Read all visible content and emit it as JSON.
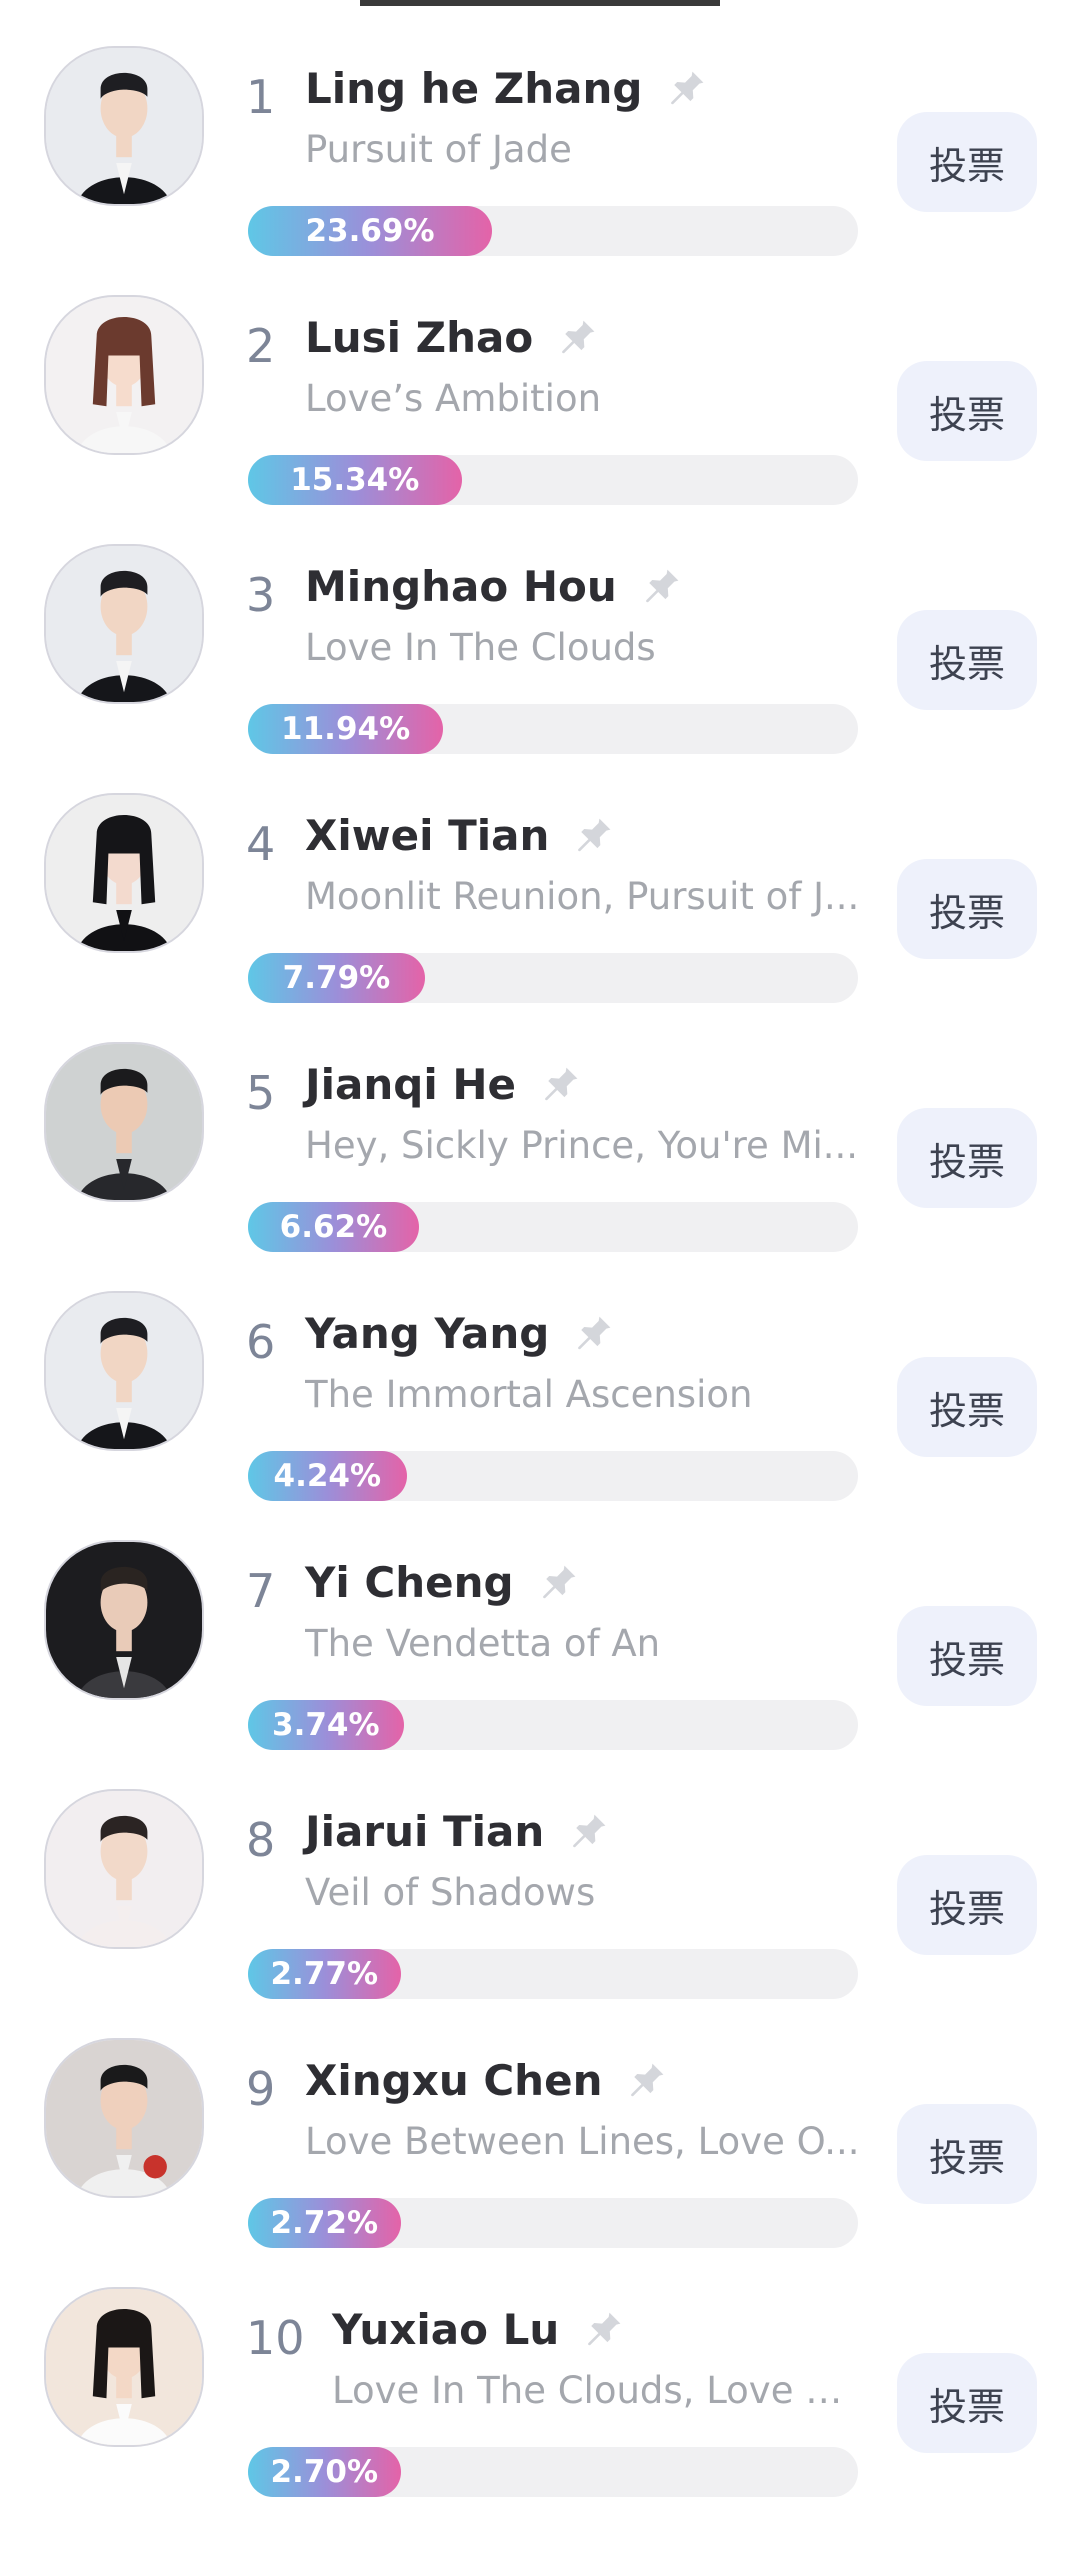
{
  "vote_label": "投票",
  "colors": {
    "bar_gradient_start": "#5fc7e6",
    "bar_gradient_end": "#e463a8",
    "vote_button_bg": "#eef1fb",
    "track_bg": "#f0f0f2"
  },
  "ranking": [
    {
      "rank": "1",
      "name": "Ling he Zhang",
      "work": "Pursuit of Jade",
      "percent_label": "23.69%",
      "share_fraction": 0.4,
      "avatar": "avatar-male-black-suit"
    },
    {
      "rank": "2",
      "name": "Lusi Zhao",
      "work": "Love’s Ambition",
      "percent_label": "15.34%",
      "share_fraction": 0.35,
      "avatar": "avatar-female-white-dress"
    },
    {
      "rank": "3",
      "name": "Minghao Hou",
      "work": "Love In The Clouds",
      "percent_label": "11.94%",
      "share_fraction": 0.32,
      "avatar": "avatar-male-black-suit"
    },
    {
      "rank": "4",
      "name": "Xiwei Tian",
      "work": "Moonlit Reunion, Pursuit of J...",
      "percent_label": "7.79%",
      "share_fraction": 0.29,
      "avatar": "avatar-female-black-dress"
    },
    {
      "rank": "5",
      "name": "Jianqi He",
      "work": "Hey, Sickly Prince, You're Mi...",
      "percent_label": "6.62%",
      "share_fraction": 0.28,
      "avatar": "avatar-male-portrait"
    },
    {
      "rank": "6",
      "name": "Yang Yang",
      "work": "The Immortal Ascension",
      "percent_label": "4.24%",
      "share_fraction": 0.26,
      "avatar": "avatar-male-black-suit"
    },
    {
      "rank": "7",
      "name": "Yi Cheng",
      "work": "The Vendetta of An",
      "percent_label": "3.74%",
      "share_fraction": 0.255,
      "avatar": "avatar-male-dark-jacket"
    },
    {
      "rank": "8",
      "name": "Jiarui Tian",
      "work": "Veil of Shadows",
      "percent_label": "2.77%",
      "share_fraction": 0.25,
      "avatar": "avatar-male-white-outfit"
    },
    {
      "rank": "9",
      "name": "Xingxu Chen",
      "work": "Love Between Lines, Love O...",
      "percent_label": "2.72%",
      "share_fraction": 0.25,
      "avatar": "avatar-male-holding-apple"
    },
    {
      "rank": "10",
      "name": "Yuxiao Lu",
      "work": "Love In The Clouds, Love B...",
      "percent_label": "2.70%",
      "share_fraction": 0.25,
      "avatar": "avatar-female-white-top"
    }
  ]
}
